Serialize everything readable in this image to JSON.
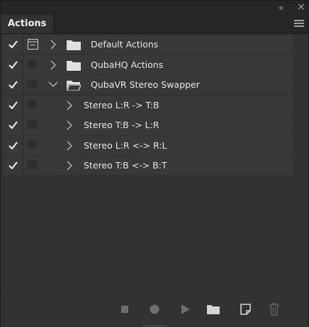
{
  "window": {
    "collapse_glyph": "«",
    "close_glyph": "×"
  },
  "panel": {
    "tab_label": "Actions"
  },
  "actions": [
    {
      "label": "Default Actions",
      "kind": "set",
      "expanded": false,
      "checked": true,
      "dialog_toggle": true
    },
    {
      "label": "QubaHQ Actions",
      "kind": "set",
      "expanded": false,
      "checked": true,
      "dialog_toggle": false
    },
    {
      "label": "QubaVR Stereo Swapper",
      "kind": "set",
      "expanded": true,
      "checked": true,
      "dialog_toggle": false
    },
    {
      "label": "Stereo L:R -> T:B",
      "kind": "action",
      "expanded": false,
      "checked": true,
      "dialog_toggle": false
    },
    {
      "label": "Stereo T:B -> L:R",
      "kind": "action",
      "expanded": false,
      "checked": true,
      "dialog_toggle": false
    },
    {
      "label": "Stereo L:R <-> R:L",
      "kind": "action",
      "expanded": false,
      "checked": true,
      "dialog_toggle": false
    },
    {
      "label": "Stereo T:B <-> B:T",
      "kind": "action",
      "expanded": false,
      "checked": true,
      "dialog_toggle": false
    }
  ],
  "toolbar": {
    "buttons": [
      "stop-icon",
      "record-icon",
      "play-icon",
      "new-set-icon",
      "new-action-icon",
      "trash-icon"
    ]
  },
  "colors": {
    "panel_bg": "#323232",
    "row_bg": "#383838",
    "text": "#e6e6e6",
    "icon": "#d0d0d0"
  }
}
